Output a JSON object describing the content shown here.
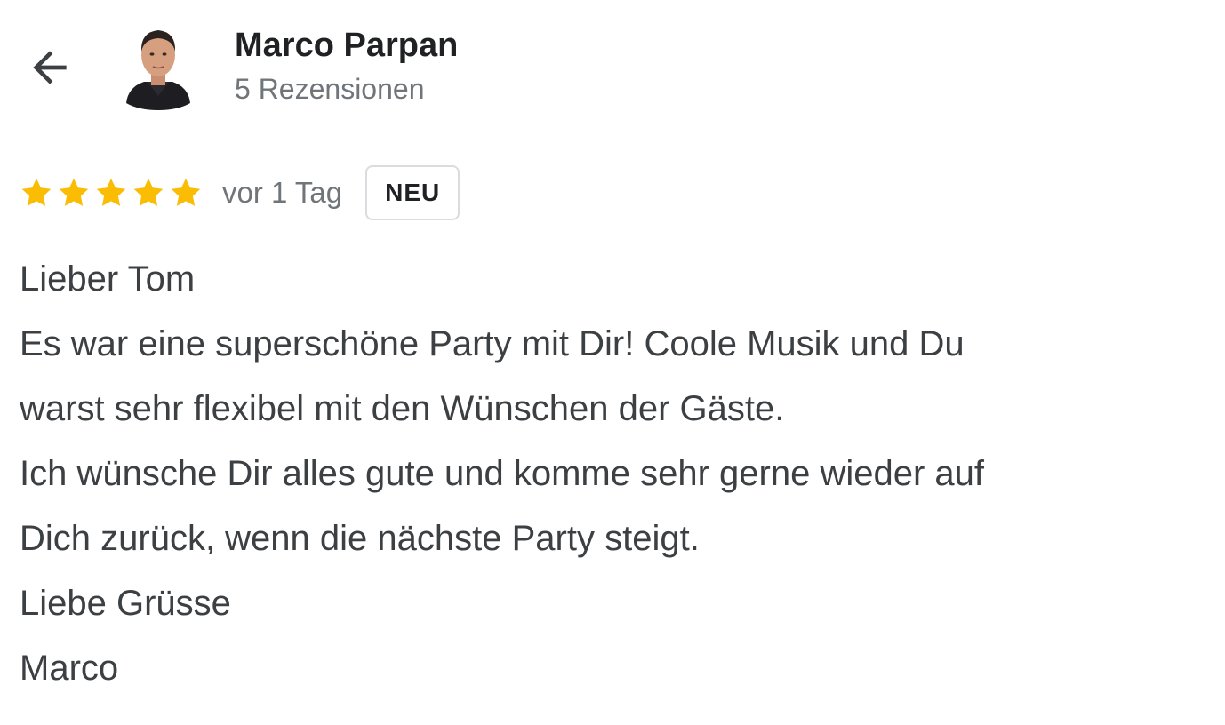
{
  "header": {
    "back_icon": "arrow-left-icon",
    "avatar_icon": "avatar-photo",
    "reviewer_name": "Marco Parpan",
    "review_count": "5 Rezensionen"
  },
  "review": {
    "rating": 5,
    "rating_max": 5,
    "star_color": "#fbbc04",
    "time_ago": "vor 1 Tag",
    "badge": "NEU",
    "lines": [
      "Lieber Tom",
      "Es war eine superschöne Party mit Dir! Coole Musik und Du",
      "warst sehr flexibel mit den Wünschen der Gäste.",
      "Ich wünsche Dir alles gute und komme sehr gerne wieder auf",
      "Dich zurück, wenn die nächste Party steigt.",
      "Liebe Grüsse",
      "Marco"
    ]
  }
}
